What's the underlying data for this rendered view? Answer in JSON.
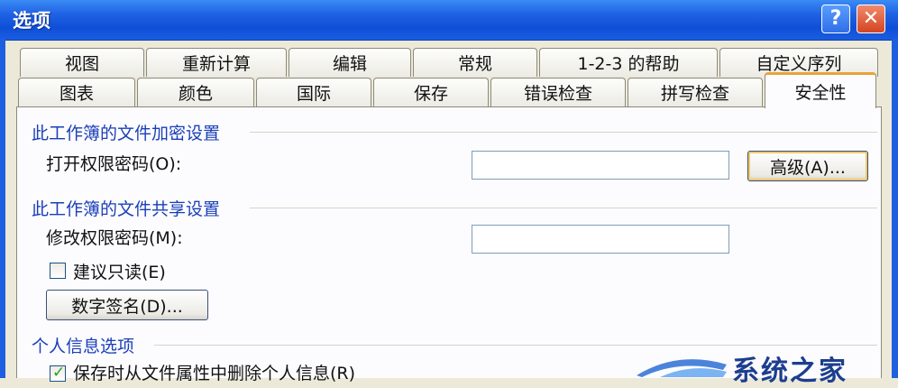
{
  "window": {
    "title": "选项",
    "help_glyph": "?",
    "close_glyph": "✕"
  },
  "tabs": {
    "row_back": [
      "视图",
      "重新计算",
      "编辑",
      "常规",
      "1-2-3 的帮助",
      "自定义序列"
    ],
    "row_front": [
      "图表",
      "颜色",
      "国际",
      "保存",
      "错误检查",
      "拼写检查",
      "安全性"
    ],
    "active": "安全性"
  },
  "encryption": {
    "title": "此工作簿的文件加密设置",
    "open_password_label": "打开权限密码(O):",
    "open_password_value": "",
    "advanced_button": "高级(A)..."
  },
  "sharing": {
    "title": "此工作簿的文件共享设置",
    "modify_password_label": "修改权限密码(M):",
    "modify_password_value": "",
    "readonly_label": "建议只读(E)",
    "readonly_checked": false,
    "digital_signature_button": "数字签名(D)..."
  },
  "privacy": {
    "title": "个人信息选项",
    "remove_info_label": "保存时从文件属性中删除个人信息(R)",
    "remove_info_checked": true
  },
  "watermark": {
    "text": "系统之家"
  },
  "colors": {
    "titlebar": "#1f62e4",
    "section_title": "#1a3fb8",
    "active_tab_accent": "#e9a33a",
    "dialog_bg": "#ece9d8"
  }
}
